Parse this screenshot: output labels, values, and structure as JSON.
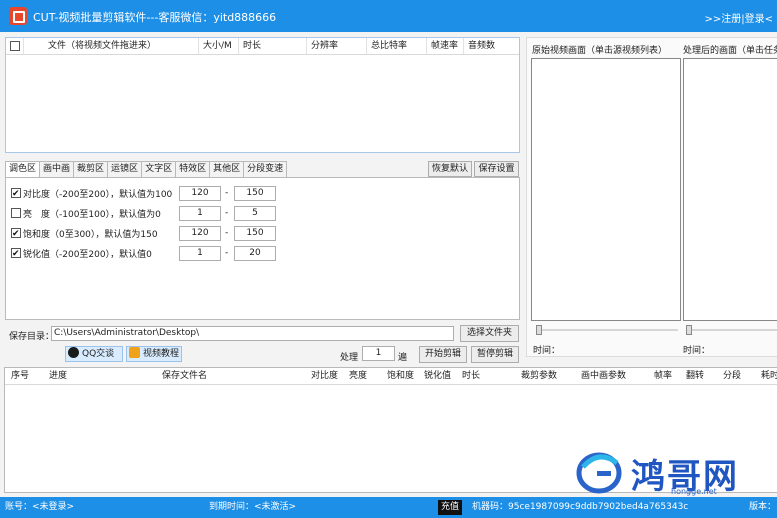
{
  "titlebar": {
    "title": "CUT-视频批量剪辑软件---客服微信：yitd888666",
    "links": ">>注册|登录<"
  },
  "file_table": {
    "columns": [
      "文件（将视频文件拖进来）",
      "大小/M",
      "时长",
      "分辨率",
      "总比特率",
      "帧速率",
      "音频数"
    ]
  },
  "tabs": [
    "调色区",
    "画中画",
    "裁剪区",
    "运镜区",
    "文字区",
    "特效区",
    "其他区",
    "分段变速"
  ],
  "buttons": {
    "restore_default": "恢复默认",
    "save_settings": "保存设置",
    "choose_folder": "选择文件夹",
    "start_edit": "开始剪辑",
    "pause_edit": "暂停剪辑"
  },
  "options": [
    {
      "label": "对比度（-200至200），默认值为100",
      "checked": true,
      "min": "120",
      "max": "150"
    },
    {
      "label": "亮　度（-100至100），默认值为0",
      "checked": false,
      "min": "1",
      "max": "5"
    },
    {
      "label": "饱和度（0至300），默认值为150",
      "checked": true,
      "min": "120",
      "max": "150"
    },
    {
      "label": "锐化值（-200至200），默认值0",
      "checked": true,
      "min": "1",
      "max": "20"
    }
  ],
  "save": {
    "label": "保存目录：",
    "path": "C:\\Users\\Administrator\\Desktop\\"
  },
  "badges": {
    "qq": "QQ交谈",
    "video": "视频教程"
  },
  "process": {
    "label": "处理",
    "count": "1",
    "unit": "遍"
  },
  "preview": {
    "original_title": "原始视频画面（单击源视频列表）",
    "processed_title": "处理后的画面（单击任务",
    "time_label_1": "时间：",
    "time_label_2": "时间："
  },
  "task_table": {
    "columns": [
      "序号",
      "进度",
      "保存文件名",
      "对比度",
      "亮度",
      "饱和度",
      "锐化值",
      "时长",
      "裁剪参数",
      "画中画参数",
      "帧率",
      "翻转",
      "分段",
      "耗时"
    ]
  },
  "statusbar": {
    "account": "账号：<未登录>",
    "expiry": "到期时间：<未激活>",
    "charge": "充值",
    "machine_code": "机器码：95ce1987099c9ddb7902bed4a765343c",
    "version": "版本："
  },
  "watermark": {
    "text": "鸿哥网",
    "sub": "hongge.net"
  },
  "colors": {
    "titlebar": "#1e8fe6",
    "statusbar": "#1e8fe6"
  }
}
